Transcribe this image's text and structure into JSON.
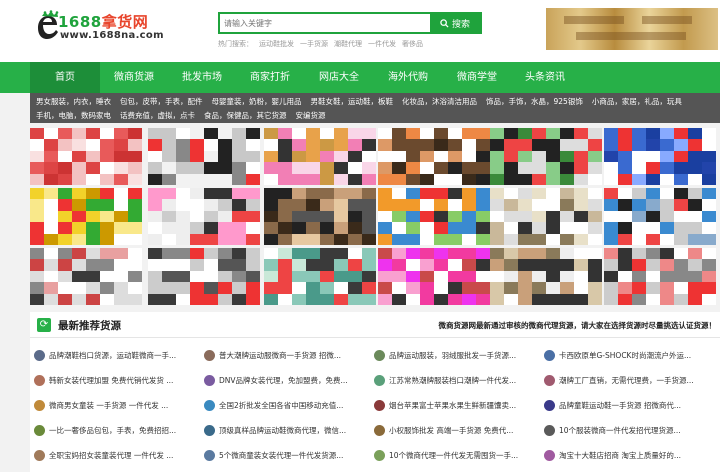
{
  "header": {
    "logo_num": "1688",
    "logo_cn": "拿货网",
    "logo_url": "www.1688na.com",
    "search_placeholder": "请输入关键字",
    "search_button": "搜索",
    "hot_label": "热门搜索：",
    "hot_keywords": [
      "运动鞋批发",
      "一手货源",
      "潮鞋代理",
      "一件代发",
      "奢侈品"
    ]
  },
  "nav": {
    "items": [
      "首页",
      "微商货源",
      "批发市场",
      "商家打折",
      "网店大全",
      "海外代购",
      "微商学堂",
      "头条资讯"
    ],
    "active_index": 0
  },
  "categories": {
    "row1": [
      "男女服装，内衣，睡衣",
      "包包，皮带，手表，配件",
      "母婴童装，奶粉，婴儿用品",
      "男鞋女鞋，运动鞋，板鞋",
      "化妆品，沐浴清洁用品",
      "饰品，手饰，水晶，925银饰",
      "小商品，家居，礼品，玩具"
    ],
    "row2": [
      "手机，电脑，数码家电",
      "话费充值，虚拟，点卡",
      "食品，保健品，其它货源",
      "安编货源"
    ]
  },
  "recommend": {
    "title": "最新推荐货源",
    "note": "微商货源网最新通过审核的微商代理货源，请大家在选择货源时尽量挑选认证货源！",
    "items": [
      "品牌潮鞋档口货源，运动鞋微商一手...",
      "普大潮牌运动服微商一手货源 招微...",
      "品牌运动服装，羽绒服批发一手货源...",
      "卡西欧原单G-SHOCK时尚潮流户外运...",
      "韩新女装代理加盟 免费代销代发货 ...",
      "DNV品牌女装代理，免加盟费，免费...",
      "江苏常熟潮牌服装档口潮牌一件代发...",
      "潮牌工厂直销，无需代理费，一手货源...",
      "微商男女童装 一手货源 一件代发 ...",
      "全国2折批发全国各省中国移动充值...",
      "烟台苹果富士苹果水果生鲜新疆馕卖...",
      "品牌童鞋运动鞋一手货源 招微商代...",
      "一比一奢侈品包包，手表，免费招招...",
      "顶级真样品牌运动鞋微商代理，微信...",
      "小权服饰批发 高端一手货源 免费代...",
      "10个服装微商一件代发招代理货源...",
      "全职宝妈招女装童装代理 一件代发 ...",
      "5个微商童装女装代理一件代发货源...",
      "10个微商代理一件代发无需囤货一手...",
      "淘宝十大鞋店招商 淘宝上质量好的..."
    ]
  },
  "colors": {
    "brand_green": "#27b048",
    "nav_active": "#1d8e39",
    "category_bar": "#555555",
    "logo_red": "#e8452c"
  }
}
